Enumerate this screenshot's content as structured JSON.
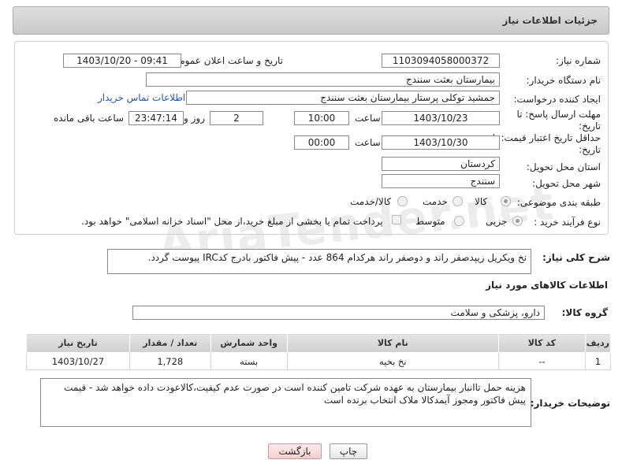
{
  "header": {
    "title": "جزئیات اطلاعات نیاز"
  },
  "fields": {
    "need_number_label": "شماره نیاز:",
    "need_number": "1103094058000372",
    "announce_label": "تاریخ و ساعت اعلان عمومی:",
    "announce_value": "1403/10/20 - 09:41",
    "buyer_org_label": "نام دستگاه خریدار:",
    "buyer_org": "بیمارستان بعثت سنندج",
    "creator_label": "ایجاد کننده درخواست:",
    "creator": "جمشید  توکلی پرستار بیمارستان بعثت سنندج",
    "contact_link": "اطلاعات تماس خریدار",
    "deadline_label": "مهلت ارسال پاسخ: تا تاریخ:",
    "deadline_date": "1403/10/23",
    "time_label": "ساعت",
    "deadline_time": "10:00",
    "days_count": "2",
    "days_label": "روز و",
    "remaining_time": "23:47:14",
    "remaining_label": "ساعت باقی مانده",
    "validity_label": "حداقل تاریخ اعتبار قیمت: تا تاریخ:",
    "validity_date": "1403/10/30",
    "validity_time": "00:00",
    "province_label": "استان محل تحویل:",
    "province": "کردستان",
    "city_label": "شهر محل تحویل:",
    "city": "سنندج",
    "category_label": "طبقه بندی موضوعی:",
    "category_options": [
      "کالا",
      "خدمت",
      "کالا/خدمت"
    ],
    "process_label": "نوع فرآیند خرید :",
    "process_options": [
      "جزیی",
      "متوسط"
    ],
    "payment_note": "پرداخت تمام یا بخشی از مبلغ خرید،از محل \"اسناد خزانه اسلامی\" خواهد بود."
  },
  "description": {
    "label": "شرح کلی نیاز:",
    "text": "نخ ویکریل زیپدصفر راند و دوصفر راند هرکدام 864 عدد - پیش فاکتور بادرج کدIRC پیوست گردد."
  },
  "goods_section_title": "اطلاعات کالاهای مورد نیاز",
  "goods_group": {
    "label": "گروه کالا:",
    "value": "دارو، پزشکی و سلامت"
  },
  "table": {
    "headers": [
      "ردیف",
      "کد کالا",
      "نام کالا",
      "واحد شمارش",
      "تعداد / مقدار",
      "تاریخ نیاز"
    ],
    "rows": [
      [
        "1",
        "--",
        "نخ بخیه",
        "بسته",
        "1,728",
        "1403/10/27"
      ]
    ]
  },
  "buyer_notes": {
    "label": "توضیحات خریدار:",
    "text": "هزینه حمل تاانبار بیمارستان به عهده شرکت تامین کننده است در صورت عدم کیفیت،کالاعودت داده خواهد شد - قیمت پیش فاکتور ومجوز آیمدکالا ملاک انتخاب برنده است"
  },
  "buttons": {
    "print": "چاپ",
    "back": "بازگشت"
  },
  "watermark": "AriaTender.net"
}
